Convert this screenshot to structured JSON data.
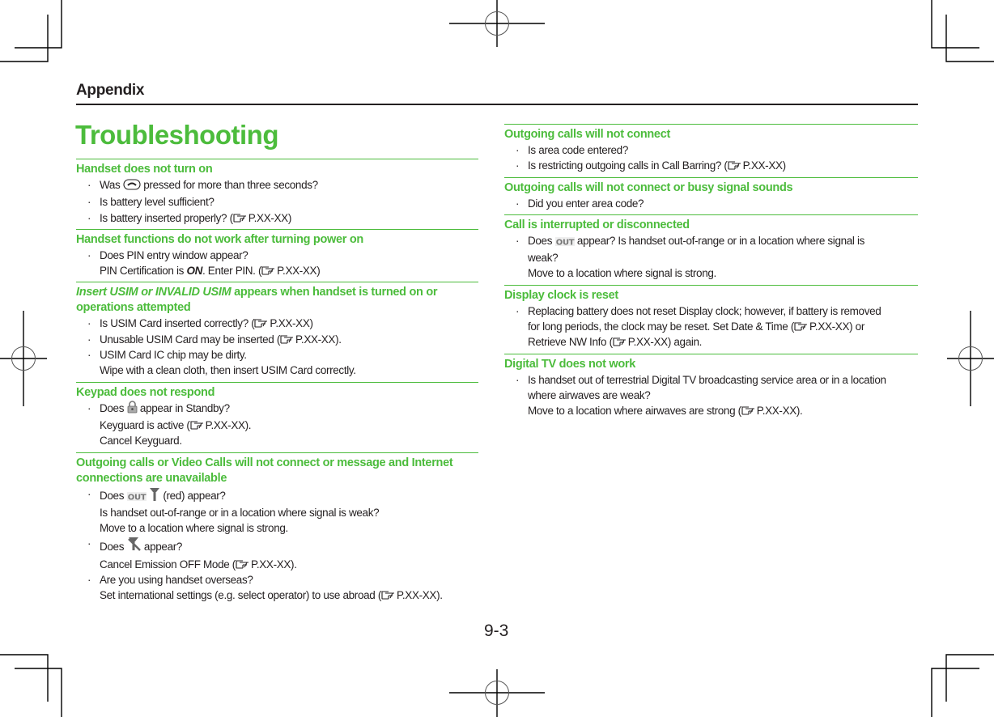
{
  "header": {
    "title": "Appendix"
  },
  "page_title": "Troubleshooting",
  "page_number": "9-3",
  "ref_label": "P.XX-XX",
  "left_sections": [
    {
      "title": "Handset does not turn on",
      "items": [
        {
          "parts": [
            "Was ",
            "[end-key-icon]",
            " pressed for more than three seconds?"
          ]
        },
        {
          "parts": [
            "Is battery level sufficient?"
          ]
        },
        {
          "parts": [
            "Is battery inserted properly? (",
            "[ref]",
            ")"
          ]
        }
      ]
    },
    {
      "title": "Handset functions do not work after turning power on",
      "items": [
        {
          "lines": [
            "Does PIN entry window appear?",
            "PIN Certification is ON. Enter PIN. (P.XX-XX)"
          ]
        }
      ]
    },
    {
      "title_italic": "Insert USIM or INVALID USIM",
      "title": " appears when handset is turned on or operations attempted",
      "items": [
        {
          "parts": [
            "Is USIM Card inserted correctly? (",
            "[ref]",
            ")"
          ]
        },
        {
          "parts": [
            "Unusable USIM Card may be inserted (",
            "[ref]",
            ")."
          ]
        },
        {
          "lines": [
            "USIM Card IC chip may be dirty.",
            "Wipe with a clean cloth, then insert USIM Card correctly."
          ]
        }
      ]
    },
    {
      "title": "Keypad does not respond",
      "items": [
        {
          "lines": [
            "Does [lock-icon] appear in Standby?",
            "Keyguard is active (P.XX-XX).",
            "Cancel Keyguard."
          ]
        }
      ]
    },
    {
      "title": "Outgoing calls or Video Calls will not connect or message and Internet connections are unavailable",
      "items": [
        {
          "lines": [
            "Does [out-icon] [antenna-icon] (red) appear?",
            "Is handset out-of-range or in a location where signal is weak?",
            "Move to a location where signal is strong."
          ]
        },
        {
          "lines": [
            "Does [emission-off-icon] appear?",
            "Cancel Emission OFF Mode (P.XX-XX)."
          ]
        },
        {
          "lines": [
            "Are you using handset overseas?",
            "Set international settings (e.g. select operator) to use abroad (P.XX-XX)."
          ]
        }
      ]
    }
  ],
  "text": {
    "s1_i1_a": "Was ",
    "s1_i1_b": " pressed for more than three seconds?",
    "s1_i2": "Is battery level sufficient?",
    "s1_i3": "Is battery inserted properly? (",
    "s2_i1_l1": "Does PIN entry window appear?",
    "s2_i1_l2a": "PIN Certification is ",
    "s2_i1_on": "ON",
    "s2_i1_l2b": ". Enter PIN. (",
    "s3_t_italic": "Insert USIM or INVALID USIM",
    "s3_t_rest": " appears when handset is turned on or operations attempted",
    "s3_i1": "Is USIM Card inserted correctly? (",
    "s3_i2": "Unusable USIM Card may be inserted (",
    "s3_i3_l1": "USIM Card IC chip may be dirty.",
    "s3_i3_l2": "Wipe with a clean cloth, then insert USIM Card correctly.",
    "s4_i1_a": "Does ",
    "s4_i1_b": " appear in Standby?",
    "s4_i1_l2": "Keyguard is active (",
    "s4_i1_l3": "Cancel Keyguard.",
    "s5_i1_a": "Does ",
    "s5_i1_b": " (red) appear?",
    "s5_i1_l2": "Is handset out-of-range or in a location where signal is weak?",
    "s5_i1_l3": "Move to a location where signal is strong.",
    "s5_i2_a": "Does ",
    "s5_i2_b": " appear?",
    "s5_i2_l2": "Cancel Emission OFF Mode (",
    "s5_i3_l1": "Are you using handset overseas?",
    "s5_i3_l2": "Set international settings (e.g. select operator) to use abroad (",
    "r1_t": "Outgoing calls will not connect",
    "r1_i1": "Is area code entered?",
    "r1_i2": "Is restricting outgoing calls in Call Barring? (",
    "r2_t": "Outgoing calls will not connect or busy signal sounds",
    "r2_i1": "Did you enter area code?",
    "r3_t": "Call is interrupted or disconnected",
    "r3_i1_a": "Does ",
    "r3_i1_b": " appear? Is handset out-of-range or in a location where signal is",
    "r3_i1_l2": "weak?",
    "r3_i1_l3": "Move to a location where signal is strong.",
    "r4_t": "Display clock is reset",
    "r4_i1_l1": "Replacing battery does not reset Display clock; however, if battery is removed",
    "r4_i1_l2": "for long periods, the clock may be reset. Set Date & Time (",
    "r4_i1_l2b": ") or",
    "r4_i1_l3": "Retrieve NW Info (",
    "r4_i1_l3b": ") again.",
    "r5_t": "Digital TV does not work",
    "r5_i1_l1": "Is handset out of terrestrial Digital TV broadcasting service area or in a location",
    "r5_i1_l2": "where airwaves are weak?",
    "r5_i1_l3": "Move to a location where airwaves are strong (",
    "close_paren": ")",
    "close_paren_dot": ").",
    "bullet": "·"
  },
  "colors": {
    "accent": "#4cbc3c",
    "text": "#231f20"
  }
}
